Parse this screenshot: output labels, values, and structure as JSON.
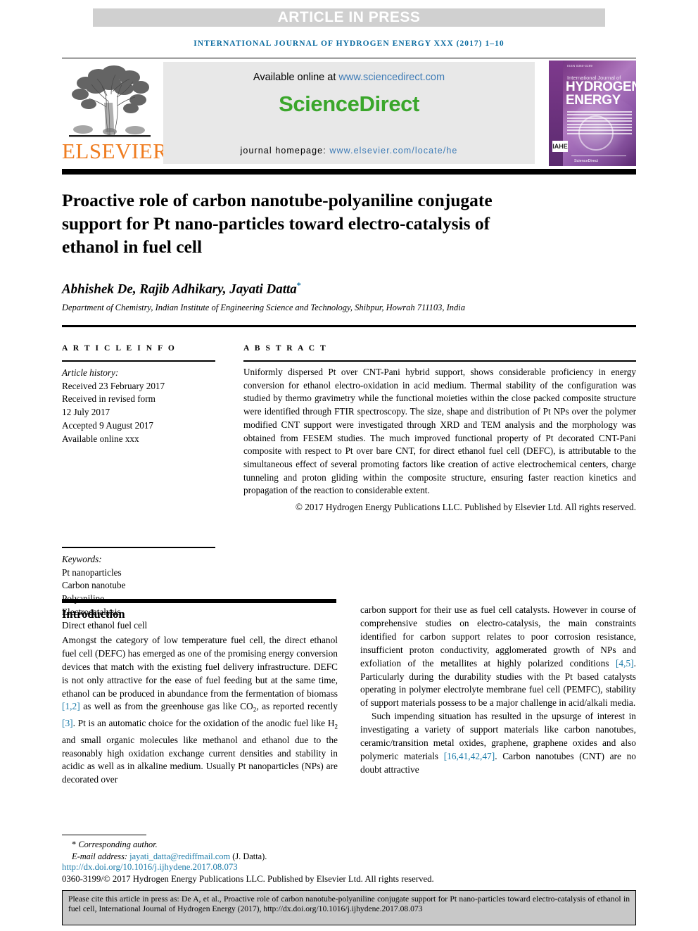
{
  "banner": {
    "article_in_press": "ARTICLE IN PRESS"
  },
  "running_head": "INTERNATIONAL JOURNAL OF HYDROGEN ENERGY XXX (2017) 1–10",
  "masthead": {
    "publisher_name": "ELSEVIER",
    "available_online_prefix": "Available online at ",
    "sciencedirect_url": "www.sciencedirect.com",
    "sciencedirect_logo": "ScienceDirect",
    "journal_homepage_label": "journal homepage: ",
    "journal_homepage_url": "www.elsevier.com/locate/he",
    "cover": {
      "top_note": "ISSN 0360-3199",
      "small_title": "International Journal of",
      "line1": "HYDROGEN",
      "line2": "ENERGY",
      "badge": "IAHE",
      "imprint": "ScienceDirect"
    }
  },
  "article": {
    "title": "Proactive role of carbon nanotube-polyaniline conjugate support for Pt nano-particles toward electro-catalysis of ethanol in fuel cell",
    "authors": "Abhishek De, Rajib Adhikary, Jayati Datta",
    "corresponding_marker": "*",
    "affiliation": "Department of Chemistry, Indian Institute of Engineering Science and Technology, Shibpur, Howrah 711103, India"
  },
  "article_info": {
    "heading": "A R T I C L E   I N F O",
    "history_label": "Article history:",
    "history": [
      "Received 23 February 2017",
      "Received in revised form",
      "12 July 2017",
      "Accepted 9 August 2017",
      "Available online xxx"
    ],
    "keywords_label": "Keywords:",
    "keywords": [
      "Pt nanoparticles",
      "Carbon nanotube",
      "Polyaniline",
      "Electrocatalysis",
      "Direct ethanol fuel cell"
    ]
  },
  "abstract": {
    "heading": "A B S T R A C T",
    "body": "Uniformly dispersed Pt over CNT-Pani hybrid support, shows considerable proficiency in energy conversion for ethanol electro-oxidation in acid medium. Thermal stability of the configuration was studied by thermo gravimetry while the functional moieties within the close packed composite structure were identified through FTIR spectroscopy. The size, shape and distribution of Pt NPs over the polymer modified CNT support were investigated through XRD and TEM analysis and the morphology was obtained from FESEM studies. The much improved functional property of Pt decorated CNT-Pani composite with respect to Pt over bare CNT, for direct ethanol fuel cell (DEFC), is attributable to the simultaneous effect of several promoting factors like creation of active electrochemical centers, charge tunneling and proton gliding within the composite structure, ensuring faster reaction kinetics and propagation of the reaction to considerable extent.",
    "copyright": "© 2017 Hydrogen Energy Publications LLC. Published by Elsevier Ltd. All rights reserved."
  },
  "body": {
    "intro_heading": "Introduction",
    "left_paragraph_1_a": "Amongst the category of low temperature fuel cell, the direct ethanol fuel cell (DEFC) has emerged as one of the promising energy conversion devices that match with the existing fuel delivery infrastructure. DEFC is not only attractive for the ease of fuel feeding but at the same time, ethanol can be produced in abundance from the fermentation of biomass ",
    "ref_1_2": "[1,2]",
    "left_paragraph_1_b": " as well as from the greenhouse gas like CO",
    "left_sub_2": "2",
    "left_paragraph_1_c": ", as reported recently ",
    "ref_3": "[3]",
    "left_paragraph_1_d": ". Pt is an automatic choice for the oxidation of the anodic fuel like H",
    "left_sub_2b": "2",
    "left_paragraph_1_e": " and small organic molecules like methanol and ethanol due to the reasonably high oxidation exchange current densities and stability in acidic as well as in alkaline medium. Usually Pt nanoparticles (NPs) are decorated over",
    "right_paragraph_1_a": "carbon support for their use as fuel cell catalysts. However in course of comprehensive studies on electro-catalysis, the main constraints identified for carbon support relates to poor corrosion resistance, insufficient proton conductivity, agglomerated growth of NPs and exfoliation of the metallites at highly polarized conditions ",
    "ref_4_5": "[4,5]",
    "right_paragraph_1_b": ". Particularly during the durability studies with the Pt based catalysts operating in polymer electrolyte membrane fuel cell (PEMFC), stability of support materials possess to be a major challenge in acid/alkali media.",
    "right_paragraph_2_a": "Such impending situation has resulted in the upsurge of interest in investigating a variety of support materials like carbon nanotubes, ceramic/transition metal oxides, graphene, graphene oxides and also polymeric materials ",
    "ref_16": "[16,41,42,47]",
    "right_paragraph_2_b": ". Carbon nanotubes (CNT) are no doubt attractive"
  },
  "footer": {
    "corresponding_marker": "*",
    "corresponding_author": "Corresponding author.",
    "email_label": "E-mail address: ",
    "email": "jayati_datta@rediffmail.com",
    "email_owner": " (J. Datta).",
    "doi": "http://dx.doi.org/10.1016/j.ijhydene.2017.08.073",
    "issn_copyright": "0360-3199/© 2017 Hydrogen Energy Publications LLC. Published by Elsevier Ltd. All rights reserved."
  },
  "cite_box": {
    "text": "Please cite this article in press as: De A, et al., Proactive role of carbon nanotube-polyaniline conjugate support for Pt nano-particles toward electro-catalysis of ethanol in fuel cell, International Journal of Hydrogen Energy (2017), http://dx.doi.org/10.1016/j.ijhydene.2017.08.073"
  },
  "colors": {
    "link_blue": "#1a7aa8",
    "header_blue": "#0a6ba0",
    "sciencedirect_green": "#3aa62b",
    "elsevier_orange": "#ef7c1f",
    "banner_gray": "#d0d0d0",
    "cite_box_gray": "#c8c8c8"
  }
}
